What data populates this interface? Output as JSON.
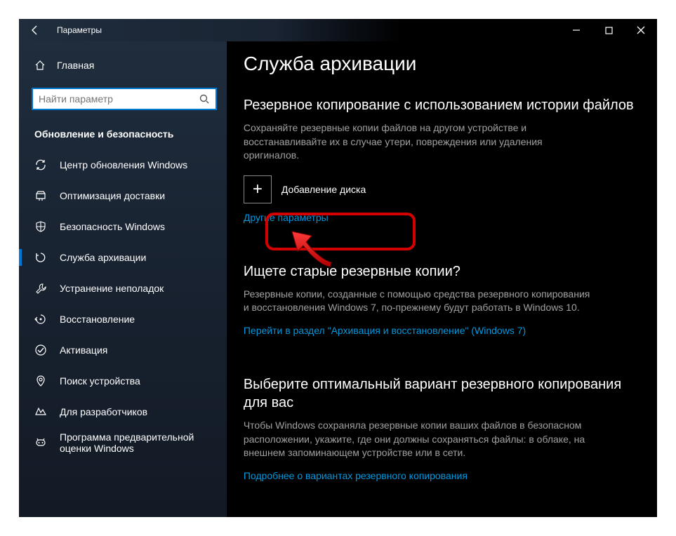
{
  "window": {
    "title": "Параметры"
  },
  "sidebar": {
    "home_label": "Главная",
    "search_placeholder": "Найти параметр",
    "category": "Обновление и безопасность",
    "items": [
      {
        "label": "Центр обновления Windows",
        "icon": "sync",
        "active": false
      },
      {
        "label": "Оптимизация доставки",
        "icon": "delivery",
        "active": false
      },
      {
        "label": "Безопасность Windows",
        "icon": "shield",
        "active": false
      },
      {
        "label": "Служба архивации",
        "icon": "backup",
        "active": true
      },
      {
        "label": "Устранение неполадок",
        "icon": "trouble",
        "active": false
      },
      {
        "label": "Восстановление",
        "icon": "recovery",
        "active": false
      },
      {
        "label": "Активация",
        "icon": "activate",
        "active": false
      },
      {
        "label": "Поиск устройства",
        "icon": "find",
        "active": false
      },
      {
        "label": "Для разработчиков",
        "icon": "dev",
        "active": false
      },
      {
        "label": "Программа предварительной оценки Windows",
        "icon": "insider",
        "active": false
      }
    ]
  },
  "page": {
    "title": "Служба архивации",
    "section1": {
      "heading": "Резервное копирование с использованием истории файлов",
      "desc": "Сохраняйте резервные копии файлов на другом устройстве и восстанавливайте их в случае утери, повреждения или удаления оригиналов.",
      "add_drive": "Добавление диска",
      "more_link": "Другие параметры"
    },
    "section2": {
      "heading": "Ищете старые резервные копии?",
      "desc": "Резервные копии, созданные с помощью средства резервного копирования и восстановления Windows 7, по-прежнему будут работать в Windows 10.",
      "link": "Перейти в раздел \"Архивация и восстановление\" (Windows 7)"
    },
    "section3": {
      "heading": "Выберите оптимальный вариант резервного копирования для вас",
      "desc": "Чтобы Windows сохраняла резервные копии ваших файлов в безопасном расположении, укажите, где они должны сохраняться файлы: в облаке, на внешнем запоминающем устройстве или в сети.",
      "link": "Подробнее о вариантах резервного копирования"
    }
  }
}
